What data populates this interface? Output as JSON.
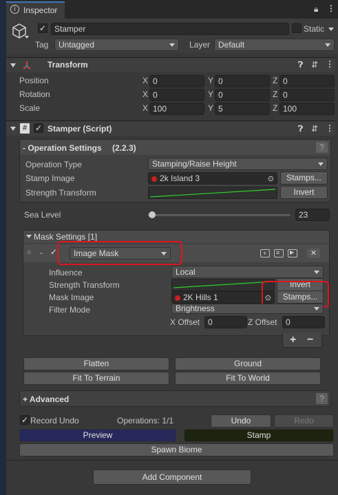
{
  "window": {
    "tab_title": "Inspector"
  },
  "object": {
    "name": "Stamper",
    "static_label": "Static",
    "tag_label": "Tag",
    "tag_value": "Untagged",
    "layer_label": "Layer",
    "layer_value": "Default"
  },
  "transform": {
    "title": "Transform",
    "rows": [
      {
        "label": "Position",
        "x": "0",
        "y": "0",
        "z": "0"
      },
      {
        "label": "Rotation",
        "x": "0",
        "y": "0",
        "z": "0"
      },
      {
        "label": "Scale",
        "x": "100",
        "y": "5",
        "z": "100"
      }
    ],
    "axis_x": "X",
    "axis_y": "Y",
    "axis_z": "Z"
  },
  "stamper": {
    "title": "Stamper (Script)",
    "operation_settings": "- Operation Settings",
    "version": "(2.2.3)",
    "help": "?",
    "operation_type_label": "Operation Type",
    "operation_type_value": "Stamping/Raise Height",
    "stamp_image_label": "Stamp Image",
    "stamp_image_value": "2k Island 3",
    "stamps_button": "Stamps...",
    "strength_transform_label": "Strength Transform",
    "invert_button": "Invert",
    "sea_level_label": "Sea Level",
    "sea_level_value": "23",
    "sea_level_fraction": 0.0,
    "mask_settings_label": "Mask Settings [1]",
    "mask": {
      "dash": "-",
      "type_value": "Image Mask",
      "influence_label": "Influence",
      "influence_value": "Local",
      "strength_transform_label": "Strength Transform",
      "invert_button": "Invert",
      "mask_image_label": "Mask Image",
      "mask_image_value": "2K Hills 1",
      "stamps_button": "Stamps...",
      "filter_mode_label": "Filter Mode",
      "filter_mode_value": "Brightness",
      "x_offset_label": "X Offset",
      "x_offset_value": "0",
      "z_offset_label": "Z Offset",
      "z_offset_value": "0",
      "add": "+",
      "remove": "−"
    },
    "buttons": {
      "flatten": "Flatten",
      "ground": "Ground",
      "fit_to_terrain": "Fit To Terrain",
      "fit_to_world": "Fit To World"
    },
    "advanced_label": "+ Advanced",
    "record_undo_label": "Record Undo",
    "operations_label": "Operations: 1/1",
    "undo_button": "Undo",
    "redo_button": "Redo",
    "preview_button": "Preview",
    "stamp_button": "Stamp",
    "spawn_biome_button": "Spawn Biome"
  },
  "add_component_button": "Add Component",
  "colors": {
    "highlight_red": "#e0141e",
    "preview_blue": "#27285a",
    "stamp_dark": "#1c240f",
    "curve_green": "#2fd02f"
  }
}
